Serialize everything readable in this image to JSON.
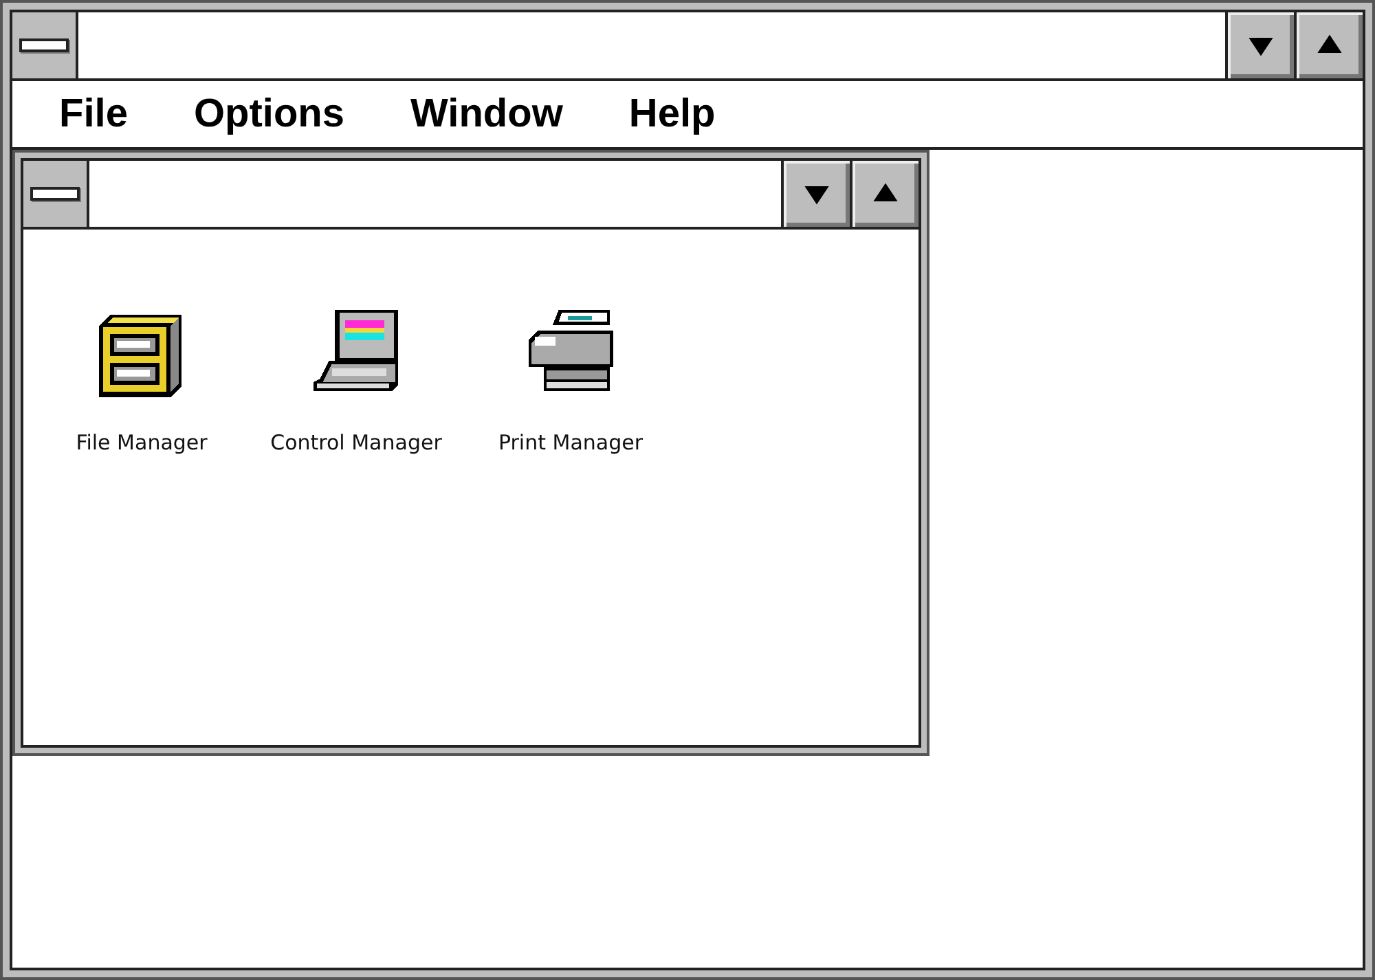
{
  "menu": [
    {
      "label": "File"
    },
    {
      "label": "Options"
    },
    {
      "label": "Window"
    },
    {
      "label": "Help"
    }
  ],
  "child_window": {
    "icons": [
      {
        "label": "File Manager",
        "kind": "cabinet"
      },
      {
        "label": "Control Manager",
        "kind": "computer"
      },
      {
        "label": "Print Manager",
        "kind": "printer"
      }
    ]
  }
}
